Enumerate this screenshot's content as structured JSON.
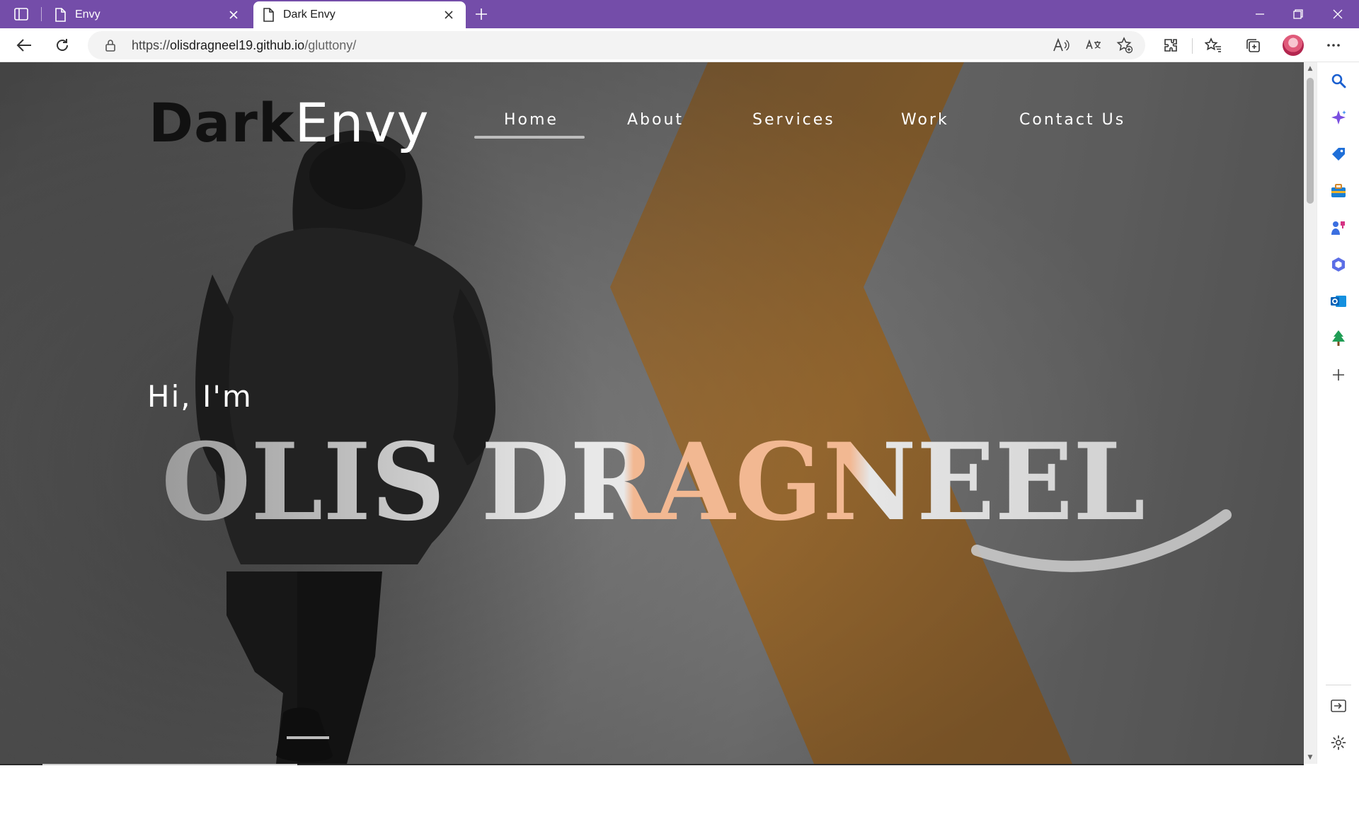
{
  "browser": {
    "tabs": [
      {
        "title": "Envy",
        "active": false
      },
      {
        "title": "Dark Envy",
        "active": true
      }
    ],
    "url": {
      "scheme": "https://",
      "host": "olisdragneel19.github.io",
      "path": "/gluttony/"
    },
    "colors": {
      "tabstrip": "#744DA9"
    }
  },
  "site": {
    "logo": {
      "dark": "Dark",
      "envy": "Envy"
    },
    "nav": [
      {
        "label": "Home",
        "active": true
      },
      {
        "label": "About",
        "active": false
      },
      {
        "label": "Services",
        "active": false
      },
      {
        "label": "Work",
        "active": false
      },
      {
        "label": "Contact Us",
        "active": false
      }
    ],
    "hero": {
      "greeting": "Hi, I'm",
      "name": "OLIS DRAGNEEL"
    },
    "colors": {
      "accent_orange": "#B07A38",
      "name_peach": "#F2B892",
      "name_light": "#E6E6E6"
    }
  }
}
